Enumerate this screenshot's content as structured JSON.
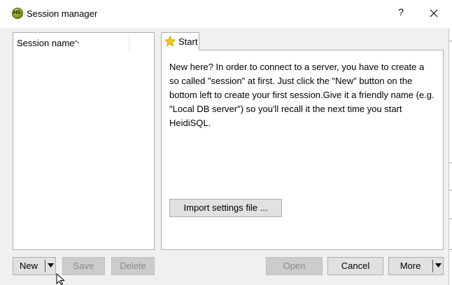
{
  "window": {
    "title": "Session manager",
    "app_icon_text": "HS",
    "help_label": "?"
  },
  "session_list": {
    "column_header": "Session name",
    "sort": "ascending",
    "items": []
  },
  "tabs": [
    {
      "label": "Start",
      "icon": "star-icon",
      "active": true
    }
  ],
  "start_panel": {
    "intro": "New here? In order to connect to a server, you have to create a so called \"session\" at first. Just click the \"New\" button on the bottom left to create your first session.Give it a friendly name (e.g. \"Local DB server\") so you'll recall it the next time you start HeidiSQL.",
    "import_button": "Import settings file ..."
  },
  "buttons": {
    "new": "New",
    "save": "Save",
    "delete": "Delete",
    "open": "Open",
    "cancel": "Cancel",
    "more": "More"
  },
  "colors": {
    "window_bg": "#f0f0f0",
    "button_bg": "#e1e1e1",
    "button_disabled_bg": "#cccccc",
    "border": "#adadad",
    "star": "#f5c518"
  }
}
